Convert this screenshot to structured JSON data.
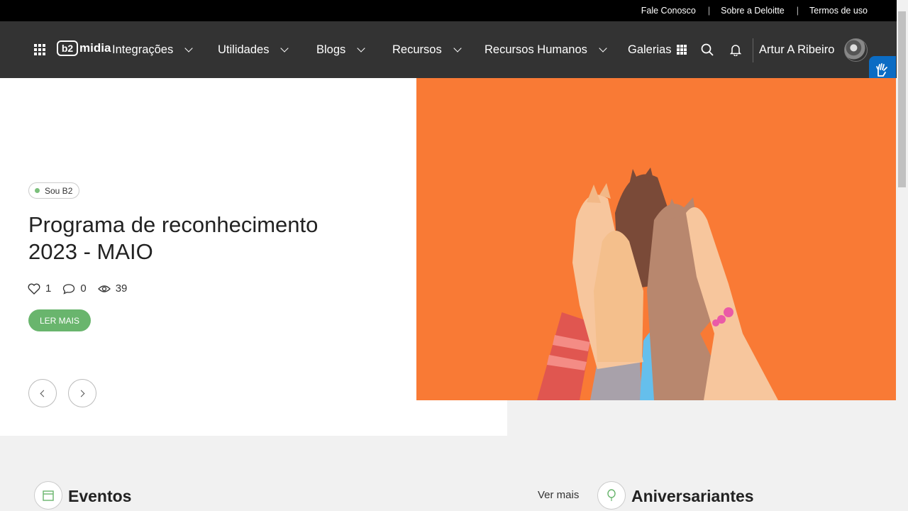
{
  "topbar": {
    "links": [
      "Fale Conosco",
      "Sobre a Deloitte",
      "Termos de uso"
    ],
    "separator": "|"
  },
  "navbar": {
    "logo": {
      "mark": "b2",
      "text": "midia"
    },
    "items": [
      {
        "label": "Integrações"
      },
      {
        "label": "Utilidades"
      },
      {
        "label": "Blogs"
      },
      {
        "label": "Recursos"
      },
      {
        "label": "Recursos Humanos"
      },
      {
        "label": "Galerias"
      }
    ],
    "user_name": "Artur A Ribeiro"
  },
  "hero": {
    "tag": "Sou B2",
    "title": "Programa de reconhecimento 2023 - MAIO",
    "likes": "1",
    "comments": "0",
    "views": "39",
    "button": "LER MAIS",
    "image_bg": "#f97a35"
  },
  "sections": {
    "events_title": "Eventos",
    "see_more": "Ver mais",
    "birthdays_title": "Aniversariantes"
  },
  "colors": {
    "accent_green": "#69b56d",
    "navbar": "#333333",
    "accessibility_blue": "#0b6cc4"
  },
  "icons": [
    "apps-grid-icon",
    "chevron-down-icon",
    "galerias-grid-icon",
    "search-icon",
    "bell-icon",
    "sign-language-icon",
    "heart-icon",
    "comment-icon",
    "eye-icon",
    "calendar-icon",
    "balloon-icon",
    "chevron-left-icon",
    "chevron-right-icon"
  ]
}
